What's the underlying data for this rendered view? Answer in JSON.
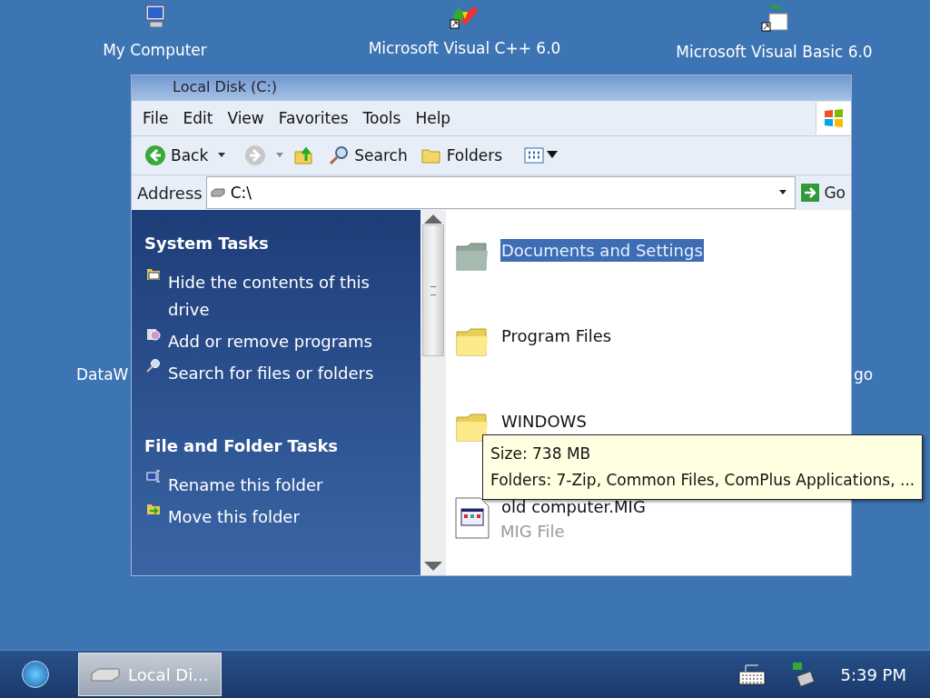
{
  "desktop_icons": [
    {
      "label": "My Computer",
      "kind": "computer"
    },
    {
      "label": "Microsoft Visual C++ 6.0",
      "kind": "vcpp"
    },
    {
      "label": "Microsoft Visual Basic 6.0",
      "kind": "vb"
    }
  ],
  "desktop_partial_labels": [
    "DataW",
    "go"
  ],
  "window": {
    "title": "Local Disk (C:)",
    "menu": [
      "File",
      "Edit",
      "View",
      "Favorites",
      "Tools",
      "Help"
    ],
    "toolbar": [
      {
        "kind": "back",
        "label": "Back"
      },
      {
        "kind": "forward"
      },
      {
        "kind": "up"
      },
      {
        "kind": "search",
        "label": "Search"
      },
      {
        "kind": "folders",
        "label": "Folders"
      },
      {
        "kind": "views"
      }
    ],
    "address": {
      "label": "Address",
      "value": "C:\\",
      "go": "Go"
    },
    "task_sections": [
      {
        "title": "System Tasks",
        "items": [
          {
            "kind": "hide",
            "label": "Hide the contents of this drive"
          },
          {
            "kind": "addremove",
            "label": "Add or remove programs"
          },
          {
            "kind": "search",
            "label": "Search for files or folders"
          }
        ]
      },
      {
        "title": "File and Folder Tasks",
        "items": [
          {
            "kind": "rename",
            "label": "Rename this folder"
          },
          {
            "kind": "move",
            "label": "Move this folder"
          }
        ]
      }
    ],
    "files": [
      {
        "kind": "system-folder",
        "name": "Documents and Settings",
        "selected": true
      },
      {
        "kind": "folder",
        "name": "Program Files",
        "selected": false
      },
      {
        "kind": "folder",
        "name": "WINDOWS",
        "selected": false
      },
      {
        "kind": "mig",
        "name": "old computer.MIG",
        "type": "MIG File",
        "selected": false
      }
    ],
    "tooltip": [
      "Size: 738 MB",
      "Folders: 7-Zip, Common Files, ComPlus Applications, ..."
    ]
  },
  "taskbar": {
    "task": "Local Di...",
    "clock": "5:39 PM"
  }
}
